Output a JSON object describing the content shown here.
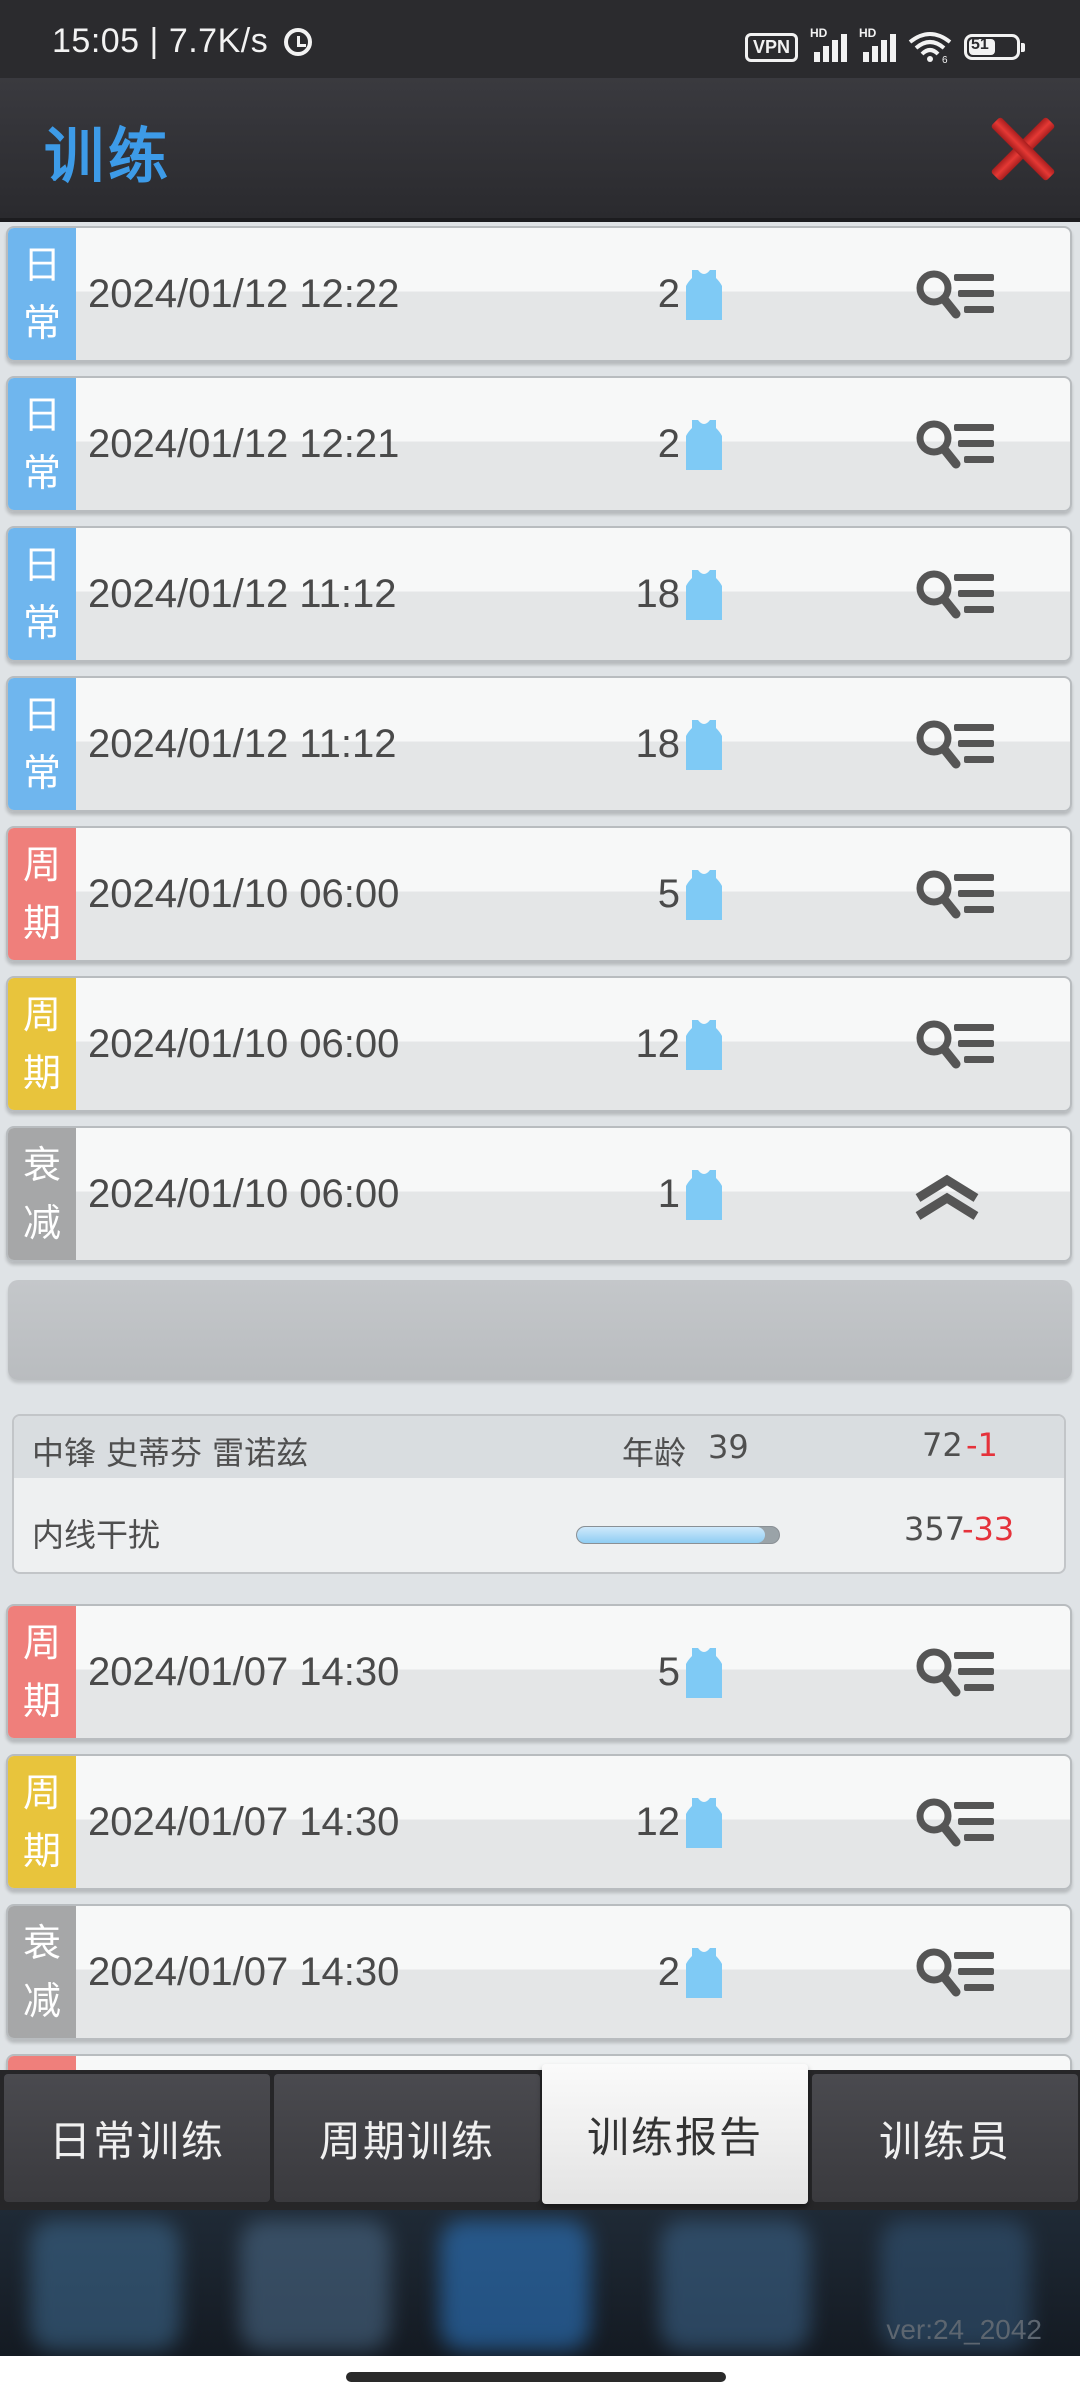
{
  "status_bar": {
    "time": "15:05",
    "speed": "7.7K/s",
    "vpn": "VPN",
    "hd1": "HD",
    "hd2": "HD",
    "wifi_sub": "6",
    "battery": "51"
  },
  "header": {
    "title": "训练",
    "close_icon": "close-icon"
  },
  "rows": [
    {
      "tag_top": "日",
      "tag_bottom": "常",
      "tag_color": "#6fb6ee",
      "date": "2024/01/12 12:22",
      "count": "2",
      "action": "detail"
    },
    {
      "tag_top": "日",
      "tag_bottom": "常",
      "tag_color": "#6fb6ee",
      "date": "2024/01/12 12:21",
      "count": "2",
      "action": "detail"
    },
    {
      "tag_top": "日",
      "tag_bottom": "常",
      "tag_color": "#6fb6ee",
      "date": "2024/01/12 11:12",
      "count": "18",
      "action": "detail"
    },
    {
      "tag_top": "日",
      "tag_bottom": "常",
      "tag_color": "#6fb6ee",
      "date": "2024/01/12 11:12",
      "count": "18",
      "action": "detail"
    },
    {
      "tag_top": "周",
      "tag_bottom": "期",
      "tag_color": "#ef7f7b",
      "date": "2024/01/10 06:00",
      "count": "5",
      "action": "detail"
    },
    {
      "tag_top": "周",
      "tag_bottom": "期",
      "tag_color": "#e8c43c",
      "date": "2024/01/10 06:00",
      "count": "12",
      "action": "detail"
    },
    {
      "tag_top": "衰",
      "tag_bottom": "减",
      "tag_color": "#a6a7a8",
      "date": "2024/01/10 06:00",
      "count": "1",
      "action": "collapse"
    },
    {
      "tag_top": "周",
      "tag_bottom": "期",
      "tag_color": "#ef7f7b",
      "date": "2024/01/07 14:30",
      "count": "5",
      "action": "detail"
    },
    {
      "tag_top": "周",
      "tag_bottom": "期",
      "tag_color": "#e8c43c",
      "date": "2024/01/07 14:30",
      "count": "12",
      "action": "detail"
    },
    {
      "tag_top": "衰",
      "tag_bottom": "减",
      "tag_color": "#a6a7a8",
      "date": "2024/01/07 14:30",
      "count": "2",
      "action": "detail"
    }
  ],
  "detail": {
    "position": "中锋",
    "player_name": "史蒂芬 雷诺兹",
    "age_label": "年龄",
    "age": "39",
    "rating": "72",
    "rating_change": "-1",
    "skill": "内线干扰",
    "skill_value": "357",
    "skill_change": "-33",
    "skill_fraction": 0.93
  },
  "tabs": [
    {
      "label": "日常训练",
      "active": false
    },
    {
      "label": "周期训练",
      "active": false
    },
    {
      "label": "训练报告",
      "active": true
    },
    {
      "label": "训练员",
      "active": false
    }
  ],
  "version": "ver:24_2042",
  "colors": {
    "accent": "#3d9be8",
    "negative": "#e5323b",
    "jersey": "#7fcaf5"
  }
}
